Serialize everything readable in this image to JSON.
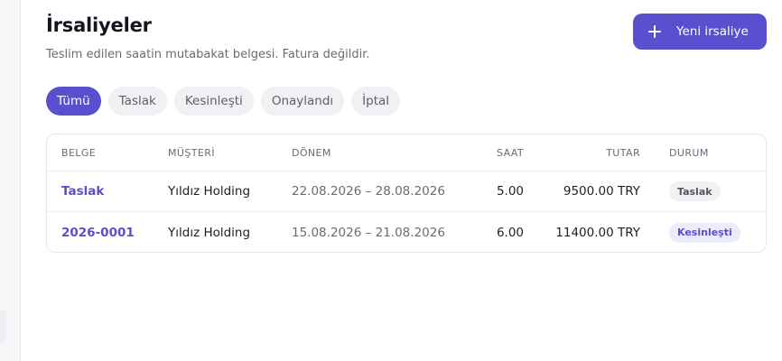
{
  "page": {
    "title": "İrsaliyeler",
    "subtitle": "Teslim edilen saatin mutabakat belgesi. Fatura değildir.",
    "new_button": "Yeni irsaliye"
  },
  "filters": [
    {
      "label": "Tümü",
      "active": true
    },
    {
      "label": "Taslak",
      "active": false
    },
    {
      "label": "Kesinleşti",
      "active": false
    },
    {
      "label": "Onaylandı",
      "active": false
    },
    {
      "label": "İptal",
      "active": false
    }
  ],
  "table": {
    "columns": {
      "doc": "BELGE",
      "customer": "MÜŞTERİ",
      "period": "DÖNEM",
      "hours": "SAAT",
      "amount": "TUTAR",
      "status": "DURUM"
    },
    "rows": [
      {
        "doc": "Taslak",
        "customer": "Yıldız Holding",
        "period": "22.08.2026 – 28.08.2026",
        "hours": "5.00",
        "amount": "9500.00 TRY",
        "status": "Taslak"
      },
      {
        "doc": "2026-0001",
        "customer": "Yıldız Holding",
        "period": "15.08.2026 – 21.08.2026",
        "hours": "6.00",
        "amount": "11400.00 TRY",
        "status": "Kesinleşti"
      }
    ]
  },
  "colors": {
    "accent": "#5a4fcf",
    "badge_final_bg": "#ecebfb",
    "badge_draft_bg": "#f1f1f4"
  },
  "icons": {
    "new_button": "plus-icon"
  }
}
